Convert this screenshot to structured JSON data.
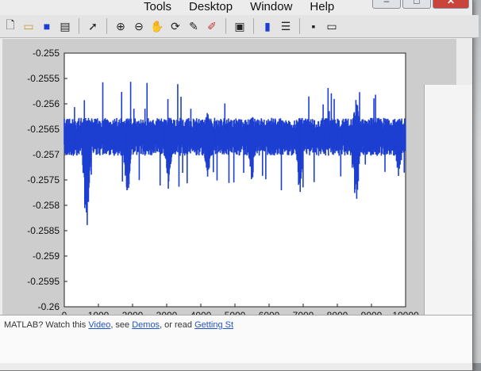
{
  "menu": [
    "Tools",
    "Desktop",
    "Window",
    "Help"
  ],
  "toolbar_icons": [
    "new-file-icon",
    "open-folder-icon",
    "save-icon",
    "print-icon",
    "pointer-icon",
    "zoom-in-icon",
    "zoom-out-icon",
    "pan-icon",
    "rotate-icon",
    "data-cursor-icon",
    "brush-icon",
    "link-icon",
    "colorbar-icon",
    "legend-icon",
    "hide-tools-icon",
    "show-tools-icon"
  ],
  "caption": {
    "minimize": "–",
    "maximize": "□",
    "close": "✕"
  },
  "command_window": {
    "text_pre": "MATLAB? Watch this ",
    "video_link": "Video",
    "mid": ", see ",
    "demos_link": "Demos",
    "tail": ", or read ",
    "getting_link": "Getting St"
  },
  "chart_data": {
    "type": "line",
    "color": "#1d3fd1",
    "xlim": [
      0,
      10000
    ],
    "ylim": [
      -0.26,
      -0.255
    ],
    "xticks": [
      0,
      1000,
      2000,
      3000,
      4000,
      5000,
      6000,
      7000,
      8000,
      9000,
      10000
    ],
    "xtick_labels": [
      "0",
      "1000",
      "2000",
      "3000",
      "4000",
      "5000",
      "6000",
      "7000",
      "8000",
      "9000",
      "10000"
    ],
    "yticks": [
      -0.255,
      -0.2555,
      -0.256,
      -0.2565,
      -0.257,
      -0.2575,
      -0.258,
      -0.2585,
      -0.259,
      -0.2595,
      -0.26
    ],
    "ytick_labels": [
      "-0.255",
      "-0.2555",
      "-0.256",
      "-0.2565",
      "-0.257",
      "-0.2575",
      "-0.258",
      "-0.2585",
      "-0.259",
      "-0.2595",
      "-0.26"
    ],
    "baseline": -0.25665,
    "band": 0.00025,
    "dips": [
      {
        "x": 650,
        "min": -0.2587,
        "max": -0.2563
      },
      {
        "x": 1850,
        "min": -0.258,
        "max": -0.2562
      },
      {
        "x": 3050,
        "min": -0.2577,
        "max": -0.2562
      },
      {
        "x": 4200,
        "min": -0.2576,
        "max": -0.2561
      },
      {
        "x": 5500,
        "min": -0.2576,
        "max": -0.2562
      },
      {
        "x": 6900,
        "min": -0.2579,
        "max": -0.2562
      },
      {
        "x": 8550,
        "min": -0.2582,
        "max": -0.2558
      },
      {
        "x": 9800,
        "min": -0.2576,
        "max": -0.2562
      }
    ]
  }
}
